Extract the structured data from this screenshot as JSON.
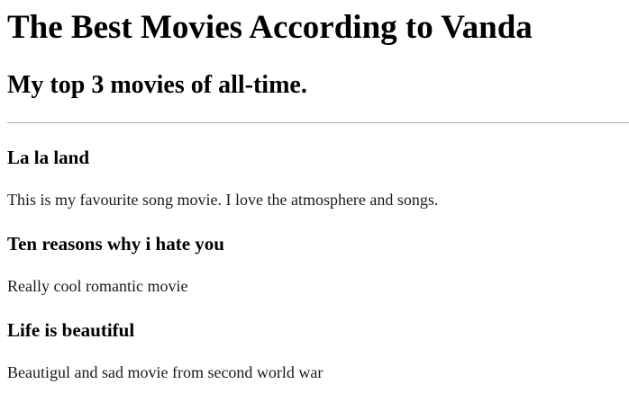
{
  "page": {
    "title": "The Best Movies According to Vanda",
    "subtitle": "My top 3 movies of all-time."
  },
  "movies": [
    {
      "title": "La la land",
      "description": "This is my favourite song movie. I love the atmosphere and songs."
    },
    {
      "title": "Ten reasons why i hate you",
      "description": "Really cool romantic movie"
    },
    {
      "title": "Life is beautiful",
      "description": "Beautigul and sad movie from second world war"
    }
  ]
}
